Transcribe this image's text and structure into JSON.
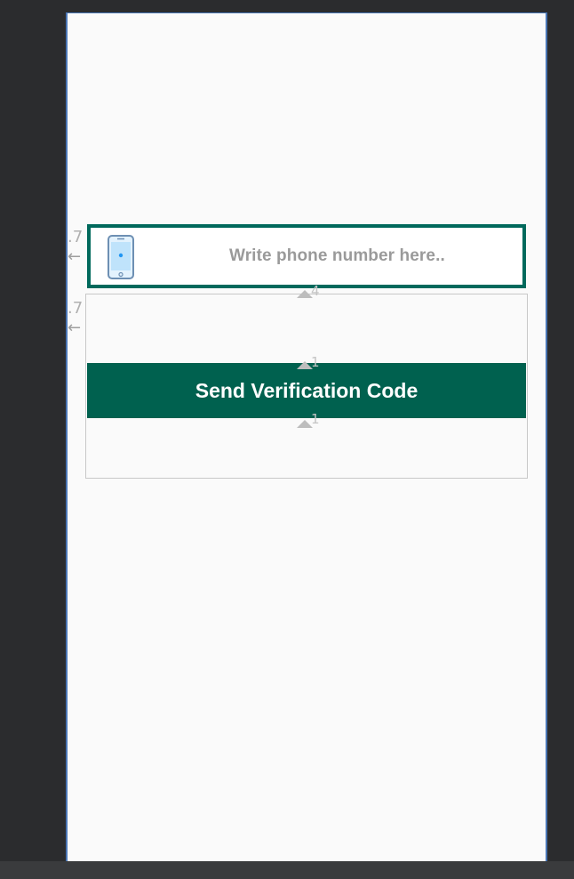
{
  "form": {
    "phone_placeholder": "Write phone number here..",
    "send_button_label": "Send Verification Code"
  },
  "constraints": {
    "left_margin_top": ".7",
    "left_margin_mid": ".7",
    "anchor_input_bottom": "4",
    "anchor_button_top": "1",
    "anchor_button_bottom": "1"
  },
  "icons": {
    "phone_icon": "smartphone-icon",
    "arrow_icon": "left-arrow-icon"
  },
  "colors": {
    "accent": "#00614f",
    "input_border": "#00695c",
    "background": "#fafafa",
    "editor_background": "#2b2c2e"
  }
}
